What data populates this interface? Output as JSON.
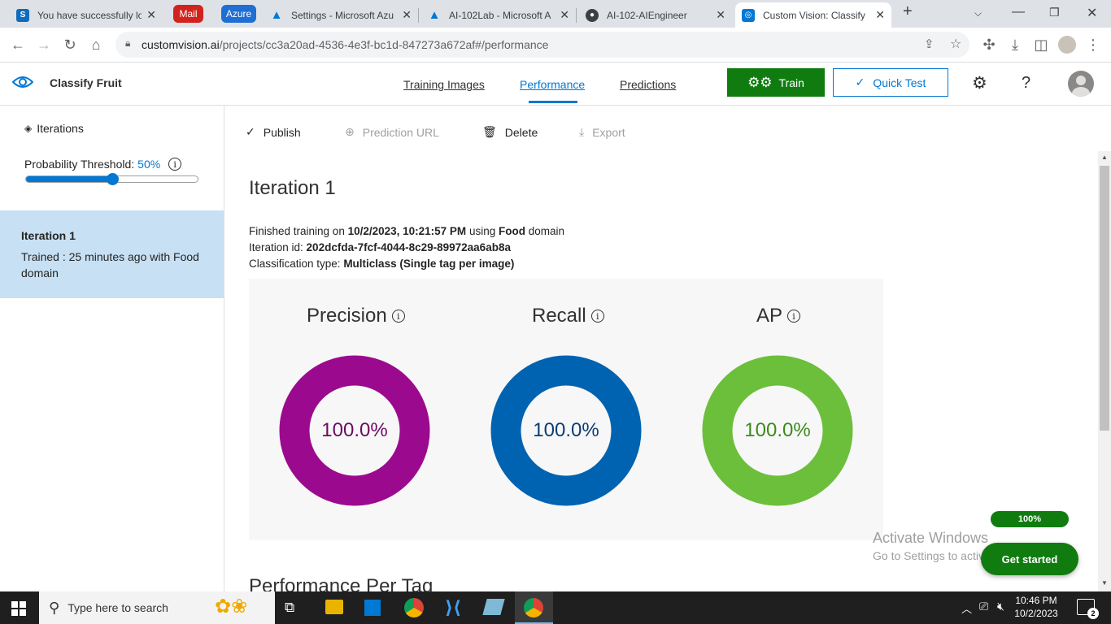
{
  "browser": {
    "tabs": [
      {
        "title": "You have successfully lo",
        "favicon": "S",
        "favicon_color": "#0f6cbd"
      },
      {
        "title": "Settings - Microsoft Azu",
        "favicon": "A",
        "favicon_color": "#0078d4"
      },
      {
        "title": "AI-102Lab - Microsoft A",
        "favicon": "A",
        "favicon_color": "#0078d4"
      },
      {
        "title": "AI-102-AIEngineer",
        "favicon": "github",
        "favicon_color": "#24292f"
      },
      {
        "title": "Custom Vision: Classify",
        "favicon": "CV",
        "favicon_color": "#0078d4"
      }
    ],
    "pills": {
      "mail": "Mail",
      "azure": "Azure"
    },
    "url_host": "customvision.ai",
    "url_path": "/projects/cc3a20ad-4536-4e3f-bc1d-847273a672af#/performance"
  },
  "app": {
    "project_name": "Classify Fruit",
    "nav": {
      "training_images": "Training Images",
      "performance": "Performance",
      "predictions": "Predictions"
    },
    "train_label": "Train",
    "quick_test_label": "Quick Test",
    "help_label": "?"
  },
  "sidebar": {
    "iterations_label": "Iterations",
    "threshold_label": "Probability Threshold:",
    "threshold_value": "50%",
    "threshold_fraction": 0.5,
    "iteration": {
      "name": "Iteration 1",
      "desc": "Trained : 25 minutes ago with Food domain"
    }
  },
  "commands": {
    "publish": "Publish",
    "prediction_url": "Prediction URL",
    "delete": "Delete",
    "export": "Export"
  },
  "iteration": {
    "title": "Iteration 1",
    "line1_prefix": "Finished training on ",
    "line1_date": "10/2/2023, 10:21:57 PM",
    "line1_mid": " using ",
    "line1_domain": "Food",
    "line1_suffix": " domain",
    "line2_prefix": "Iteration id: ",
    "line2_id": "202dcfda-7fcf-4044-8c29-89972aa6ab8a",
    "line3_prefix": "Classification type: ",
    "line3_type": "Multiclass (Single tag per image)"
  },
  "metrics": [
    {
      "name": "Precision",
      "value": "100.0%",
      "fraction": 1.0,
      "color": "#9b0a8e",
      "text_color": "#6b0a62"
    },
    {
      "name": "Recall",
      "value": "100.0%",
      "fraction": 1.0,
      "color": "#0063b1",
      "text_color": "#0b3d73"
    },
    {
      "name": "AP",
      "value": "100.0%",
      "fraction": 1.0,
      "color": "#6bbf3a",
      "text_color": "#3c8a1c"
    }
  ],
  "section_next": "Performance Per Tag",
  "overlay": {
    "activate_title": "Activate Windows",
    "activate_sub": "Go to Settings to activate Windows.",
    "progress_label": "100%",
    "get_started": "Get started"
  },
  "taskbar": {
    "search_placeholder": "Type here to search",
    "time": "10:46 PM",
    "date": "10/2/2023",
    "notifications": "2"
  }
}
